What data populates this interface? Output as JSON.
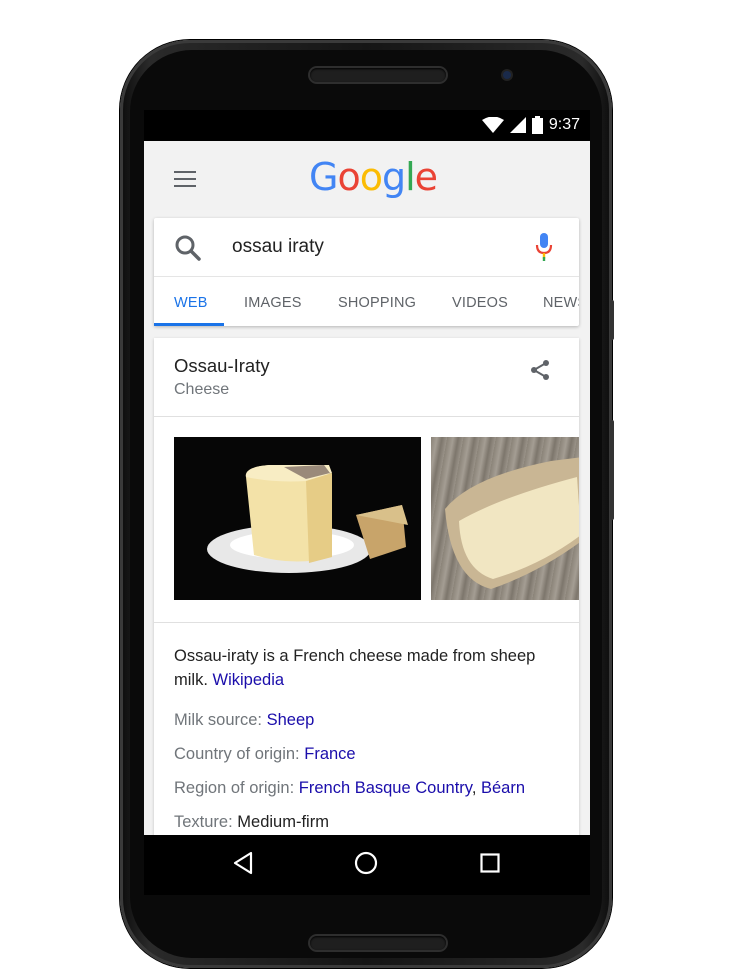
{
  "status_bar": {
    "time": "9:37",
    "icons": [
      "wifi-icon",
      "cellular-signal-icon",
      "battery-icon"
    ]
  },
  "header": {
    "logo": "Google",
    "menu_icon": "hamburger-menu-icon"
  },
  "search": {
    "query": "ossau iraty",
    "icon": "search-icon",
    "mic_icon": "microphone-icon"
  },
  "tabs": [
    {
      "label": "WEB",
      "active": true
    },
    {
      "label": "IMAGES",
      "active": false
    },
    {
      "label": "SHOPPING",
      "active": false
    },
    {
      "label": "VIDEOS",
      "active": false
    },
    {
      "label": "NEWS",
      "active": false
    }
  ],
  "knowledge_panel": {
    "title": "Ossau-Iraty",
    "subtitle": "Cheese",
    "description": "Ossau-iraty is a French cheese made from sheep milk.",
    "description_link": "Wikipedia",
    "facts": [
      {
        "label": "Milk source:",
        "values": [
          "Sheep"
        ],
        "link": true
      },
      {
        "label": "Country of origin:",
        "values": [
          "France"
        ],
        "link": true
      },
      {
        "label": "Region of origin:",
        "values": [
          "French Basque Country",
          "Béarn"
        ],
        "link": true
      },
      {
        "label": "Texture:",
        "values": [
          "Medium-firm"
        ],
        "link": false
      }
    ]
  },
  "nav": {
    "back": "back-icon",
    "home": "home-icon",
    "recents": "recents-icon"
  },
  "colors": {
    "accent": "#1a73e8",
    "link": "#1a0dab",
    "google_blue": "#4285F4",
    "google_red": "#EA4335",
    "google_yellow": "#FBBC05",
    "google_green": "#34A853"
  }
}
